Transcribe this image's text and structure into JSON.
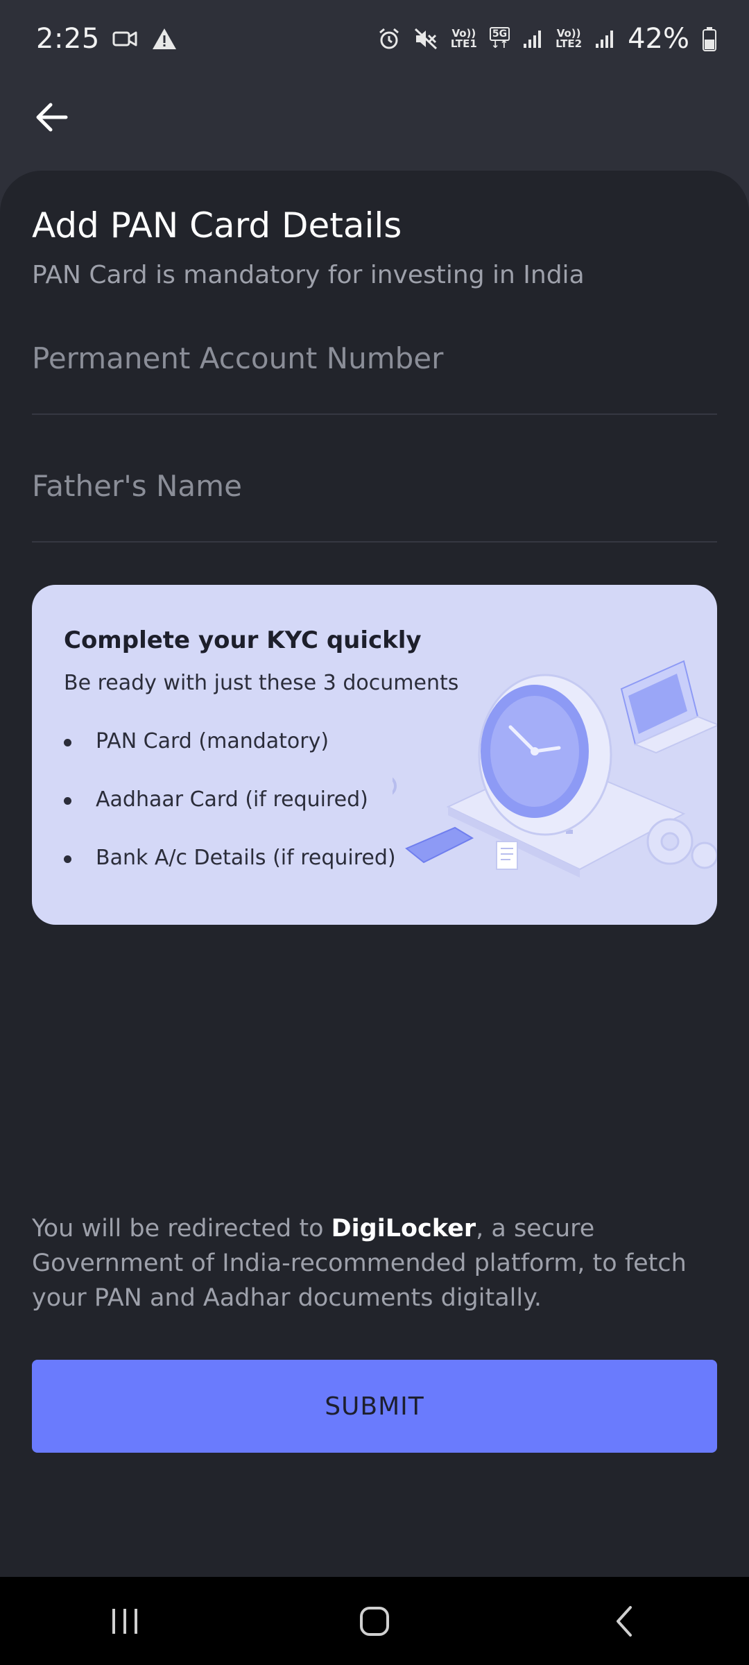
{
  "status_bar": {
    "time": "2:25",
    "sim1_top": "Vo))",
    "sim1_bottom": "LTE1",
    "network_type": "5G",
    "sim2_top": "Vo))",
    "sim2_bottom": "LTE2",
    "battery": "42%",
    "icons": [
      "video-camera-icon",
      "warning-icon",
      "alarm-icon",
      "mute-icon",
      "signal-icon",
      "battery-icon"
    ]
  },
  "header": {
    "back_icon": "arrow-left-icon"
  },
  "form": {
    "title": "Add PAN Card Details",
    "subtitle": "PAN Card is mandatory for investing in India",
    "pan_placeholder": "Permanent Account Number",
    "father_placeholder": "Father's Name"
  },
  "kyc_card": {
    "title": "Complete your KYC quickly",
    "subtitle": "Be ready with just these 3 documents",
    "items": [
      "PAN Card  (mandatory)",
      "Aadhaar Card (if required)",
      "Bank A/c Details (if required)"
    ]
  },
  "footer": {
    "redirect_prefix": "You will be redirected to ",
    "redirect_brand": "DigiLocker",
    "redirect_suffix": ", a secure Government of India-recommended platform, to fetch your PAN and Aadhar documents digitally.",
    "submit_label": "SUBMIT"
  },
  "colors": {
    "background": "#2e3039",
    "sheet": "#22242b",
    "card": "#d4d8f7",
    "accent": "#6a7bfd"
  },
  "nav_bar": {
    "icons": [
      "recent-apps-icon",
      "home-icon",
      "back-icon"
    ]
  }
}
